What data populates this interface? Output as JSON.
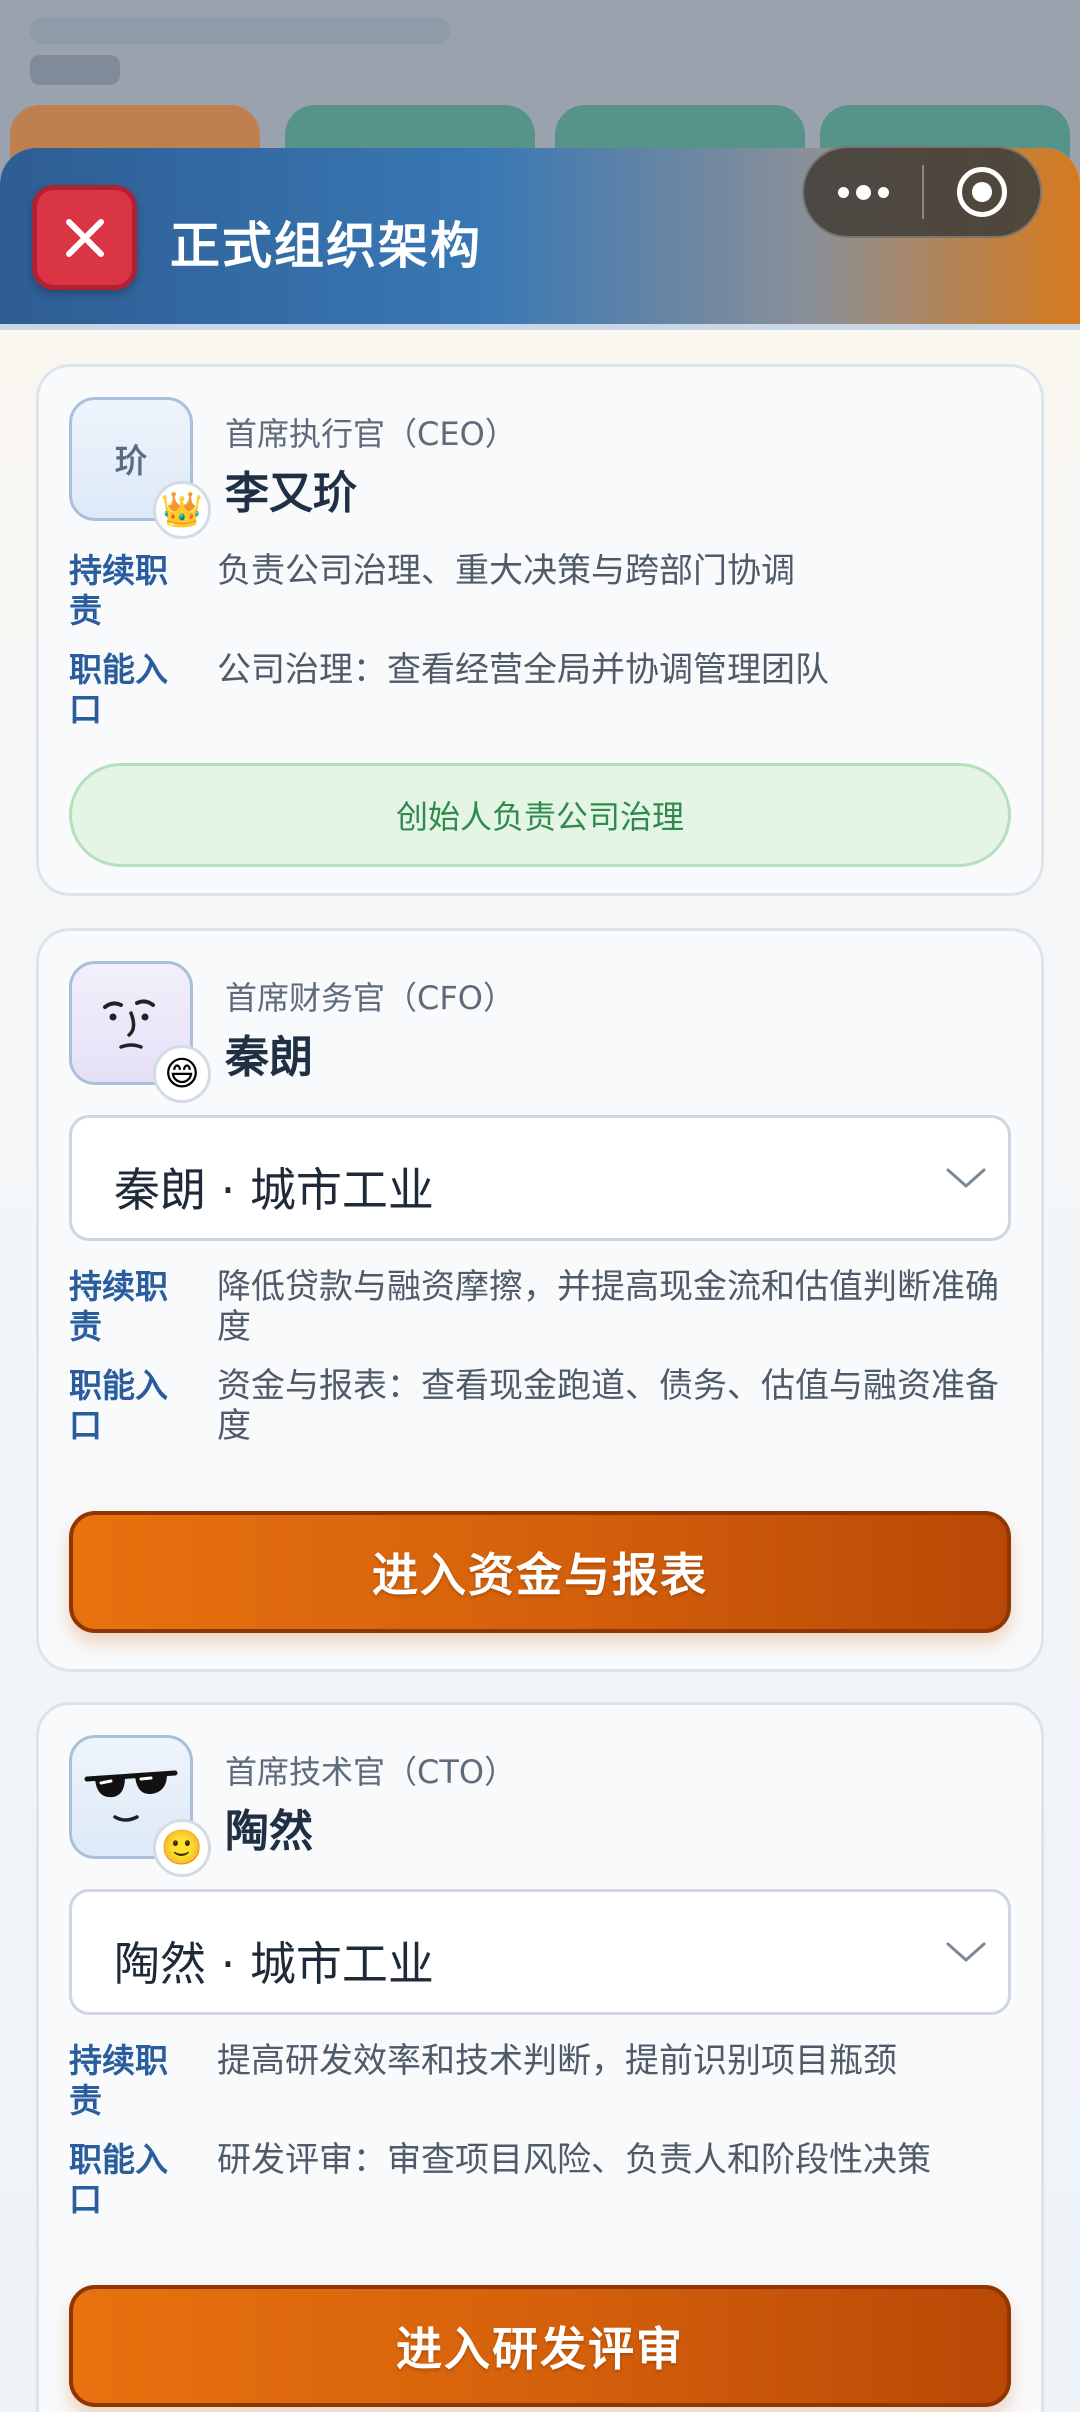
{
  "sheet": {
    "title": "正式组织架构",
    "close_icon": "close-icon"
  },
  "capsule": {
    "more_icon": "more-dots-icon",
    "record_icon": "record-target-icon"
  },
  "labels": {
    "duty": "持续职责",
    "entry": "职能入口"
  },
  "colors": {
    "accent_orange": "#d35f0b",
    "label_blue": "#2a5d9e",
    "close_red": "#d93545",
    "pill_green": "#2f8a4c"
  },
  "cards": [
    {
      "role": "首席执行官（CEO）",
      "name": "李又玠",
      "avatar_text": "玠",
      "badge_emoji": "👑",
      "duty": "负责公司治理、重大决策与跨部门协调",
      "entry": "公司治理：查看经营全局并协调管理团队",
      "status": "创始人负责公司治理"
    },
    {
      "role": "首席财务官（CFO）",
      "name": "秦朗",
      "avatar_icon": "face-sketch-icon",
      "badge_emoji": "😄",
      "select_value": "秦朗 · 城市工业",
      "duty": "降低贷款与融资摩擦，并提高现金流和估值判断准确度",
      "entry": "资金与报表：查看现金跑道、债务、估值与融资准备度",
      "button": "进入资金与报表"
    },
    {
      "role": "首席技术官（CTO）",
      "name": "陶然",
      "avatar_icon": "sunglasses-face-icon",
      "badge_emoji": "🙂",
      "select_value": "陶然 · 城市工业",
      "duty": "提高研发效率和技术判断，提前识别项目瓶颈",
      "entry": "研发评审：审查项目风险、负责人和阶段性决策",
      "button": "进入研发评审"
    }
  ]
}
